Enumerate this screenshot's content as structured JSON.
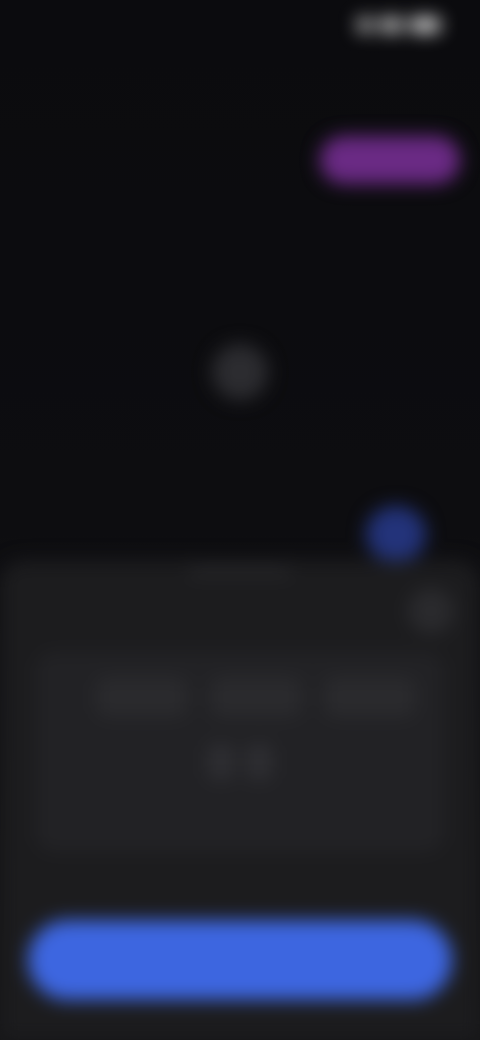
{
  "status_bar": {
    "time": "",
    "icons": [
      "signal-icon",
      "wifi-icon",
      "battery-icon"
    ]
  },
  "header": {
    "title": ""
  },
  "tabs": [
    {
      "label": "",
      "active": false
    },
    {
      "label": "",
      "active": false
    },
    {
      "label": "",
      "active": true
    }
  ],
  "empty_state": {
    "icon": "avatar-icon",
    "text": ""
  },
  "fab": {
    "icon": "plus-icon"
  },
  "sheet": {
    "title": "",
    "close_icon": "close-icon",
    "options": [
      "",
      "",
      ""
    ],
    "stepper": [
      "",
      ""
    ],
    "row_label": "",
    "row_value": "",
    "primary_button_label": ""
  },
  "colors": {
    "background": "#0b0b0d",
    "active_tab": "#6a2a84",
    "fab": "#23337a",
    "sheet": "#1c1c1e",
    "primary": "#3d66e0"
  }
}
